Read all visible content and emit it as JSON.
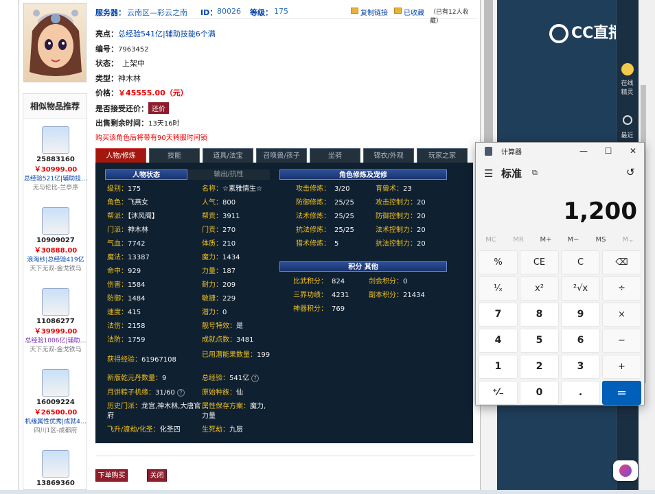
{
  "header": {
    "server_label": "服务器：",
    "server_value": "云南区—彩云之南",
    "id_label": "ID：",
    "id_value": "80026",
    "level_label": "等级：",
    "level_value": "175",
    "copy_link": "复制链接",
    "favorited": "已收藏",
    "fav_count_text": "（已有12人收藏）"
  },
  "info": {
    "highlights_label": "亮点：",
    "highlights_value": "总经验541亿|辅助技能6个满",
    "number_label": "编号：",
    "number_value": "7963452",
    "status_label": "状态：",
    "status_value": "上架中",
    "type_label": "类型：",
    "type_value": "神木林",
    "price_label": "价格：",
    "price_value": "￥45555.00（元）",
    "bargain_label": "是否接受还价：",
    "bargain_button": "还价",
    "remaining_label": "出售剩余时间：",
    "remaining_value": "13天16时",
    "notice": "购买该角色后将带有90天转服时间锁"
  },
  "similar": {
    "title": "相似物品推荐",
    "items": [
      {
        "id": "25883160",
        "price": "￥30999.00",
        "desc": "总经验521亿|辅助技…",
        "server": "无与伦比-兰亭序",
        "purple": false
      },
      {
        "id": "10909027",
        "price": "￥30888.00",
        "desc": "浪淘纱|总经验419亿",
        "server": "天下无双-金戈铁马",
        "purple": false
      },
      {
        "id": "11086277",
        "price": "￥39999.00",
        "desc": "总经验1006亿|辅助…",
        "server": "天下无双-金戈铁马",
        "purple": true
      },
      {
        "id": "16009224",
        "price": "￥26500.00",
        "desc": "机缘属性优秀|成就4…",
        "server": "四川1区-成都府",
        "purple": false
      },
      {
        "id": "13869360",
        "price": "",
        "desc": "",
        "server": "",
        "purple": false
      }
    ]
  },
  "tabs": [
    "人物/修炼",
    "技能",
    "道具/法宝",
    "召唤兽/孩子",
    "坐骑",
    "锦衣/外观",
    "玩家之家"
  ],
  "panel": {
    "char_status": "人物状态",
    "output_resist": "输出/抗性",
    "cultivation": "角色修炼及宠修",
    "points": "积分 其他",
    "left_col": [
      {
        "k": "级别：",
        "v": "175"
      },
      {
        "k": "角色：",
        "v": "飞燕女"
      },
      {
        "k": "帮派：",
        "v": "【沐风阁】"
      },
      {
        "k": "门派：",
        "v": "神木林"
      },
      {
        "k": "气血：",
        "v": "7742"
      },
      {
        "k": "魔法：",
        "v": "13387"
      },
      {
        "k": "命中：",
        "v": "929"
      },
      {
        "k": "伤害：",
        "v": "1584"
      },
      {
        "k": "防御：",
        "v": "1484"
      },
      {
        "k": "速度：",
        "v": "415"
      },
      {
        "k": "法伤：",
        "v": "2158"
      },
      {
        "k": "法防：",
        "v": "1759"
      }
    ],
    "mid_col": [
      {
        "k": "名称：",
        "v": "☆素雅情生☆"
      },
      {
        "k": "人气：",
        "v": "800"
      },
      {
        "k": "帮贡：",
        "v": "3911"
      },
      {
        "k": "门贡：",
        "v": "270"
      },
      {
        "k": "体质：",
        "v": "210"
      },
      {
        "k": "魔力：",
        "v": "1434"
      },
      {
        "k": "力量：",
        "v": "187"
      },
      {
        "k": "耐力：",
        "v": "209"
      },
      {
        "k": "敏捷：",
        "v": "229"
      },
      {
        "k": "潜力：",
        "v": "0"
      },
      {
        "k": "靓号特效：",
        "v": "是"
      },
      {
        "k": "成就点数：",
        "v": "3481"
      }
    ],
    "extra_left": [
      {
        "k": "获得经验：",
        "v": "61967108"
      },
      {
        "k": "新版乾元丹数量：",
        "v": "9"
      },
      {
        "k": "月饼粽子机缘：",
        "v": "31/60"
      },
      {
        "k": "历史门派：",
        "v": "龙宫,神木林,大唐官府"
      },
      {
        "k": "飞升/渡劫/化圣：",
        "v": "化圣四"
      }
    ],
    "extra_mid": [
      {
        "k": "已用潜能果数量：",
        "v": "199"
      },
      {
        "k": "总经验：",
        "v": "541亿"
      },
      {
        "k": "原始种族：",
        "v": "仙"
      },
      {
        "k": "属性保存方案：",
        "v": "魔力,力量"
      },
      {
        "k": "生死劫：",
        "v": "九层"
      }
    ],
    "cult_left": [
      {
        "k": "攻击修炼：",
        "v": "3/20"
      },
      {
        "k": "防御修炼：",
        "v": "25/25"
      },
      {
        "k": "法术修炼：",
        "v": "25/25"
      },
      {
        "k": "抗法修炼：",
        "v": "25/25"
      },
      {
        "k": "猎术修炼：",
        "v": "5"
      }
    ],
    "cult_right": [
      {
        "k": "育兽术：",
        "v": "23"
      },
      {
        "k": "攻击控制力：",
        "v": "20"
      },
      {
        "k": "防御控制力：",
        "v": "20"
      },
      {
        "k": "法术控制力：",
        "v": "20"
      },
      {
        "k": "抗法控制力：",
        "v": "20"
      }
    ],
    "points_left": [
      {
        "k": "比武积分：",
        "v": "824"
      },
      {
        "k": "三界功绩：",
        "v": "4231"
      },
      {
        "k": "神器积分：",
        "v": "769"
      }
    ],
    "points_right": [
      {
        "k": "剑会积分：",
        "v": "0"
      },
      {
        "k": "副本积分：",
        "v": "21434"
      }
    ]
  },
  "bottom": {
    "buy": "下单购买",
    "close": "关闭"
  },
  "cc": {
    "logo": "CC直播",
    "online_line1": "在线",
    "online_line2": "精灵",
    "recent": "最近"
  },
  "calculator": {
    "title": "计算器",
    "mode": "标准",
    "display": "1,200",
    "memory": [
      "MC",
      "MR",
      "M+",
      "M−",
      "MS",
      "M⌄"
    ],
    "keys": [
      [
        "%",
        "CE",
        "C",
        "⌫"
      ],
      [
        "¹⁄ₓ",
        "x²",
        "²√x",
        "÷"
      ],
      [
        "7",
        "8",
        "9",
        "×"
      ],
      [
        "4",
        "5",
        "6",
        "−"
      ],
      [
        "1",
        "2",
        "3",
        "+"
      ],
      [
        "⁺⁄₋",
        "0",
        ".",
        "="
      ]
    ]
  }
}
